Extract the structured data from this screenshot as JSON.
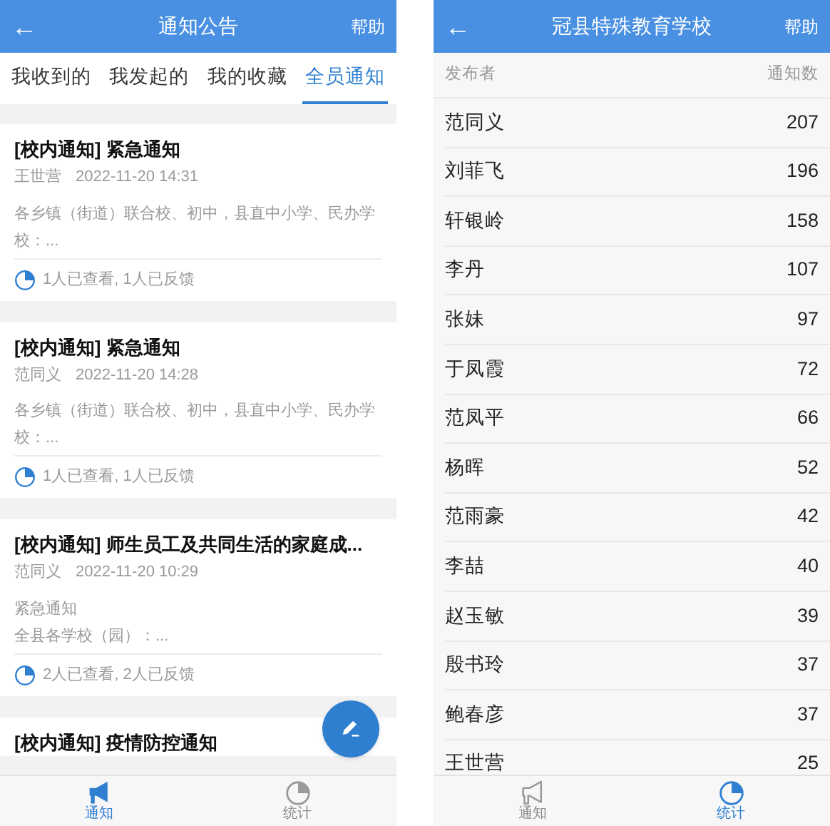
{
  "notices_screen": {
    "title": "通知公告",
    "back": "←",
    "help": "帮助",
    "tabs": [
      {
        "label": "我收到的",
        "selected": false
      },
      {
        "label": "我发起的",
        "selected": false
      },
      {
        "label": "我的收藏",
        "selected": false
      },
      {
        "label": "全员通知",
        "selected": true
      }
    ],
    "notices": [
      {
        "title": "[校内通知] 紧急通知",
        "author": "王世营",
        "time": "2022-11-20 14:31",
        "summary": [
          "各乡镇（街道）联合校、初中，县直中小学、民办学校：..."
        ],
        "stats": "1人已查看, 1人已反馈"
      },
      {
        "title": "[校内通知] 紧急通知",
        "author": "范同义",
        "time": "2022-11-20 14:28",
        "summary": [
          "各乡镇（街道）联合校、初中，县直中小学、民办学校：..."
        ],
        "stats": "1人已查看, 1人已反馈"
      },
      {
        "title": "[校内通知] 师生员工及共同生活的家庭成...",
        "author": "范同义",
        "time": "2022-11-20 10:29",
        "summary": [
          "紧急通知",
          "全县各学校（园）：..."
        ],
        "stats": "2人已查看, 2人已反馈"
      },
      {
        "title": "[校内通知] 疫情防控通知"
      }
    ],
    "nav": [
      {
        "label": "通知",
        "kind": "megaphone",
        "selected": true
      },
      {
        "label": "统计",
        "kind": "pie",
        "selected": false
      }
    ]
  },
  "stats_screen": {
    "title": "冠县特殊教育学校",
    "back": "←",
    "help": "帮助",
    "columns": [
      "发布者",
      "通知数"
    ],
    "rows": [
      {
        "name": "范同义",
        "count": "207"
      },
      {
        "name": "刘菲飞",
        "count": "196"
      },
      {
        "name": "轩银岭",
        "count": "158"
      },
      {
        "name": "李丹",
        "count": "107"
      },
      {
        "name": "张妹",
        "count": "97"
      },
      {
        "name": "于凤霞",
        "count": "72"
      },
      {
        "name": "范凤平",
        "count": "66"
      },
      {
        "name": "杨晖",
        "count": "52"
      },
      {
        "name": "范雨豪",
        "count": "42"
      },
      {
        "name": "李喆",
        "count": "40"
      },
      {
        "name": "赵玉敏",
        "count": "39"
      },
      {
        "name": "殷书玲",
        "count": "37"
      },
      {
        "name": "鲍春彦",
        "count": "37"
      },
      {
        "name": "王世营",
        "count": "25"
      }
    ],
    "nav": [
      {
        "label": "通知",
        "kind": "megaphone",
        "selected": false
      },
      {
        "label": "统计",
        "kind": "pie",
        "selected": true
      }
    ]
  }
}
